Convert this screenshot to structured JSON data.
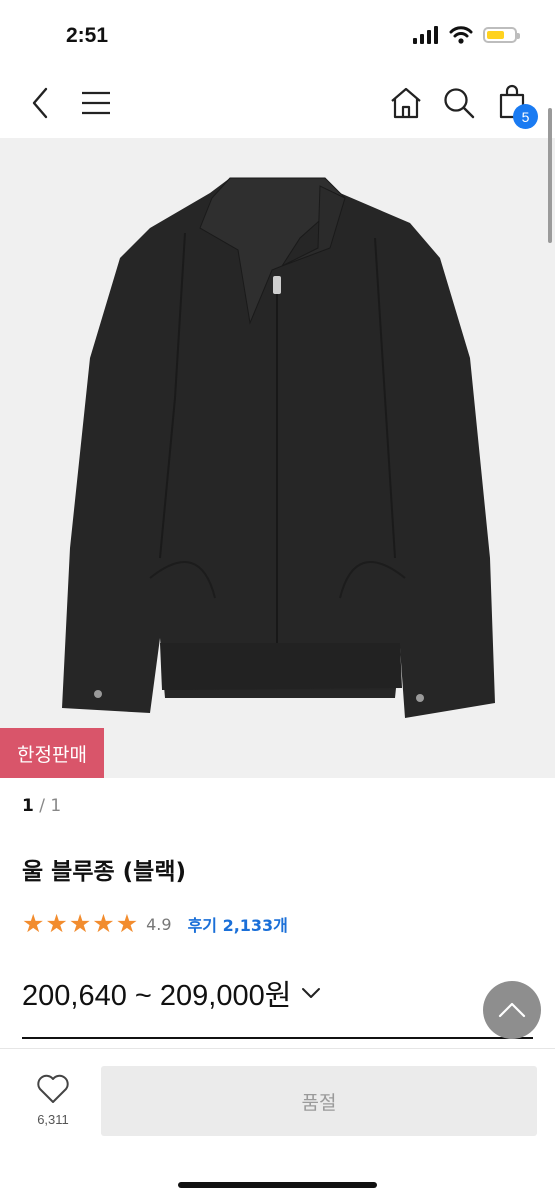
{
  "status_bar": {
    "time": "2:51",
    "battery_level": 0.65,
    "battery_color": "#ffd21f"
  },
  "nav": {
    "back_icon": "chevron-left-icon",
    "menu_icon": "hamburger-icon",
    "home_icon": "home-icon",
    "search_icon": "search-icon",
    "cart_icon": "shopping-bag-icon",
    "cart_count": "5"
  },
  "product": {
    "badge": "한정판매",
    "image_current": "1",
    "image_separator": " / ",
    "image_total": "1",
    "title": "울 블루종 (블랙)",
    "rating": 4.9,
    "rating_text": "4.9",
    "review_label": "후기 2,133개",
    "price": "200,640 ~ 209,000원"
  },
  "bottom": {
    "like_count": "6,311",
    "soldout_label": "품절"
  },
  "colors": {
    "star": "#f28c2e",
    "badge": "#d9556a",
    "review_link": "#1a6fd8",
    "cart_badge": "#1a7bf2",
    "image_bg": "#f0f0f0",
    "jacket": "#262626"
  }
}
